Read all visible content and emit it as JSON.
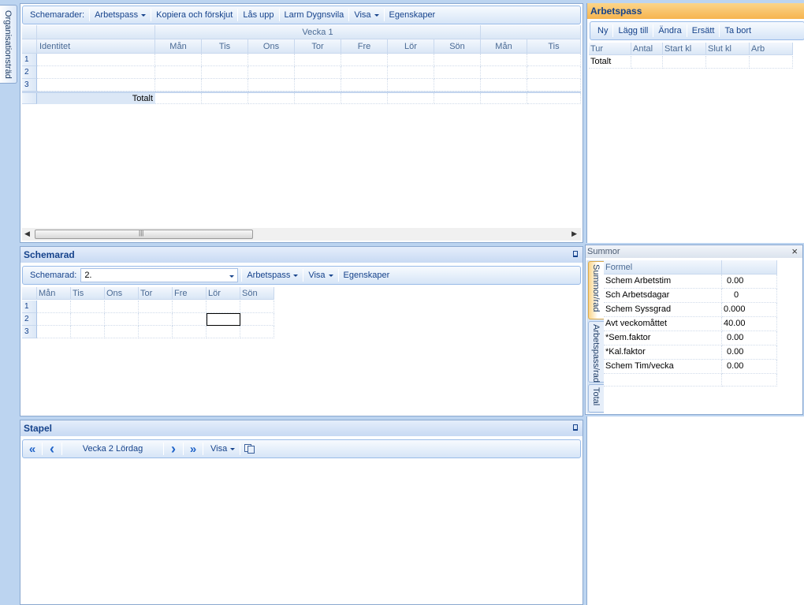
{
  "left_tab": {
    "label": "Organisationsträd"
  },
  "schema_rows": {
    "toolbar": {
      "label": "Schemarader:",
      "items": [
        "Arbetspass",
        "Kopiera och förskjut",
        "Lås upp",
        "Larm Dygnsvila",
        "Visa",
        "Egenskaper"
      ]
    },
    "week_label": "Vecka 1",
    "identity_header": "Identitet",
    "days": [
      "Mån",
      "Tis",
      "Ons",
      "Tor",
      "Fre",
      "Lör",
      "Sön",
      "Mån",
      "Tis"
    ],
    "rows": [
      "1",
      "2",
      "3"
    ],
    "total_label": "Totalt"
  },
  "arbetspass": {
    "title": "Arbetspass",
    "toolbar": [
      "Ny",
      "Lägg till",
      "Ändra",
      "Ersätt",
      "Ta bort"
    ],
    "columns": [
      "Tur",
      "Antal",
      "Start kl",
      "Slut kl",
      "Arb"
    ],
    "total_label": "Totalt"
  },
  "schemarad": {
    "title": "Schemarad",
    "toolbar": {
      "label": "Schemarad:",
      "value": "2.",
      "items": [
        "Arbetspass",
        "Visa",
        "Egenskaper"
      ]
    },
    "days": [
      "Mån",
      "Tis",
      "Ons",
      "Tor",
      "Fre",
      "Lör",
      "Sön"
    ],
    "rows": [
      "1",
      "2",
      "3"
    ]
  },
  "summor": {
    "title": "Summor",
    "close": "×",
    "tabs": [
      "Summor/rad",
      "Arbetspass/rad",
      "Total"
    ],
    "header": "Formel",
    "rows": [
      {
        "label": "Schem Arbetstim",
        "value": "0.00"
      },
      {
        "label": "Sch Arbetsdagar",
        "value": "0"
      },
      {
        "label": "Schem Syssgrad",
        "value": "0.000"
      },
      {
        "label": "Avt veckomåttet",
        "value": "40.00"
      },
      {
        "label": "*Sem.faktor",
        "value": "0.00"
      },
      {
        "label": "*Kal.faktor",
        "value": "0.00"
      },
      {
        "label": "Schem Tim/vecka",
        "value": "0.00"
      }
    ]
  },
  "stapel": {
    "title": "Stapel",
    "toolbar": {
      "period": "Vecka 2  Lördag",
      "visa": "Visa"
    }
  },
  "icons": {
    "first": "«",
    "prev": "‹",
    "next": "›",
    "last": "»",
    "scroll_left": "◀",
    "scroll_right": "▶",
    "grip": "|||"
  },
  "colors": {
    "accent_orange": "#f6b44f",
    "header_blue": "#15428b",
    "border": "#8aa8d0"
  }
}
